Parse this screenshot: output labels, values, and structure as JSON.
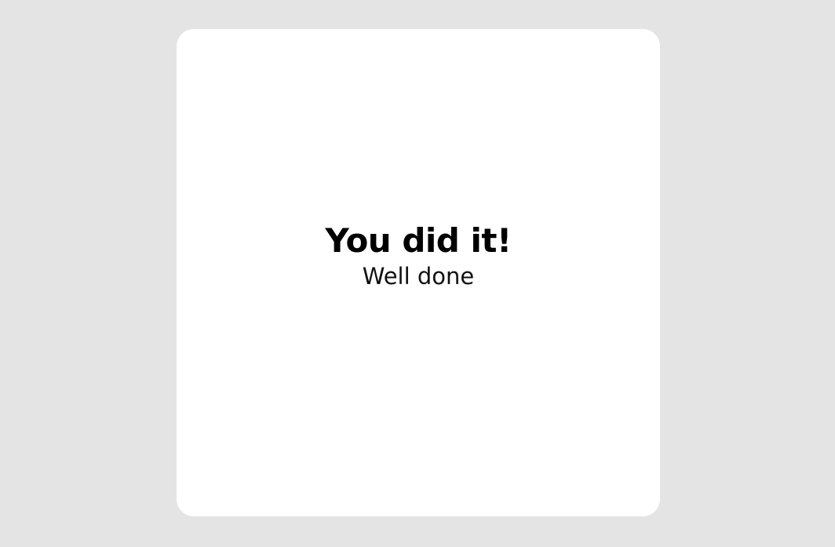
{
  "card": {
    "title": "You did it!",
    "subtitle": "Well done"
  },
  "colors": {
    "background": "#e4e4e4",
    "card": "#ffffff",
    "text": "#000000"
  }
}
